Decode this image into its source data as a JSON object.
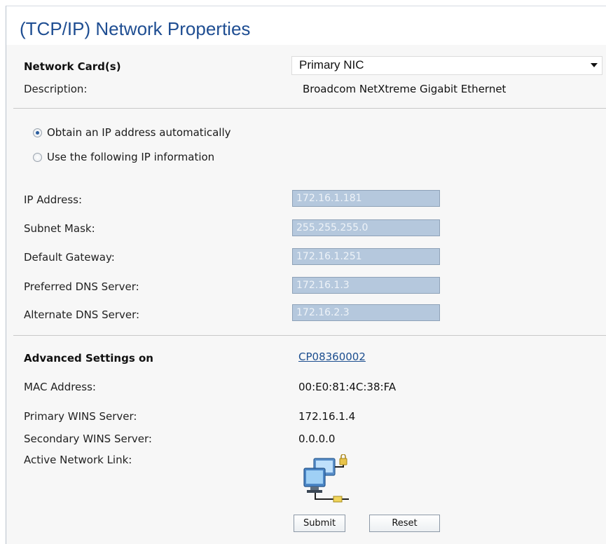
{
  "page": {
    "title": "(TCP/IP) Network Properties"
  },
  "network_card": {
    "label": "Network Card(s)",
    "selected": "Primary NIC",
    "description_label": "Description:",
    "description_value": "Broadcom NetXtreme Gigabit Ethernet"
  },
  "ip_mode": {
    "auto_label": "Obtain an IP address automatically",
    "manual_label": "Use the following IP information",
    "selected": "auto"
  },
  "ip_fields": [
    {
      "label": "IP Address:",
      "value": "172.16.1.181"
    },
    {
      "label": "Subnet Mask:",
      "value": "255.255.255.0"
    },
    {
      "label": "Default Gateway:",
      "value": "172.16.1.251"
    },
    {
      "label": "Preferred DNS Server:",
      "value": "172.16.1.3"
    },
    {
      "label": "Alternate DNS Server:",
      "value": "172.16.2.3"
    }
  ],
  "advanced": {
    "label": "Advanced Settings on",
    "host_link": "CP08360002",
    "mac_label": "MAC Address:",
    "mac_value": "00:E0:81:4C:38:FA",
    "primary_wins_label": "Primary WINS Server:",
    "primary_wins_value": "172.16.1.4",
    "secondary_wins_label": "Secondary WINS Server:",
    "secondary_wins_value": "0.0.0.0",
    "active_link_label": "Active Network Link:",
    "active_link_icon": "network-connected-icon"
  },
  "buttons": {
    "submit": "Submit",
    "reset": "Reset"
  }
}
